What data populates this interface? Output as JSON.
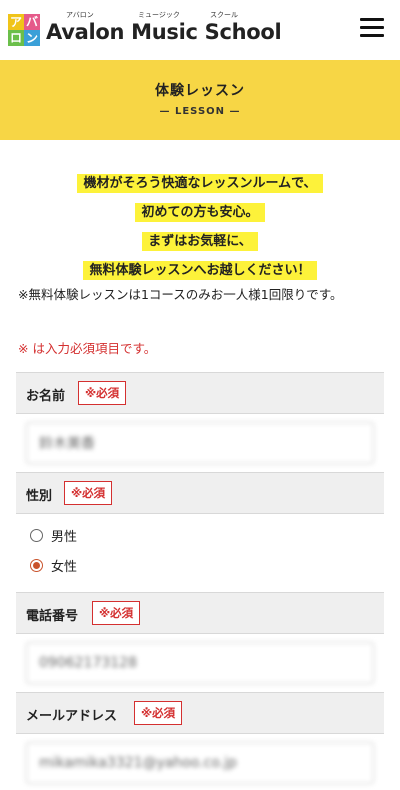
{
  "header": {
    "logo_glyphs": [
      "ア",
      "バ",
      "ロ",
      "ン"
    ],
    "name": "Avalon Music School",
    "ruby": [
      "アバロン",
      "ミュージック",
      "スクール"
    ]
  },
  "banner": {
    "title": "体験レッスン",
    "subtitle": "— LESSON —"
  },
  "intro": {
    "lines": [
      "機材がそろう快適なレッスンルームで、",
      "初めての方も安心。",
      "まずはお気軽に、",
      "無料体験レッスンへお越しください！"
    ]
  },
  "note": "※無料体験レッスンは1コースのみお一人様1回限りです。",
  "required_note": "※ は入力必須項目です。",
  "required_badge": "※必須",
  "form": {
    "name": {
      "label": "お名前",
      "value": "鈴木美香"
    },
    "gender": {
      "label": "性別",
      "options": [
        "男性",
        "女性"
      ],
      "selected": "女性"
    },
    "phone": {
      "label": "電話番号",
      "value": "09062173128"
    },
    "email": {
      "label": "メールアドレス",
      "value": "mikamika3321@yahoo.co.jp"
    }
  },
  "colors": {
    "banner": "#f7d645",
    "highlight": "#fdf23a",
    "required": "#d43030",
    "radio_checked": "#c9532c"
  }
}
